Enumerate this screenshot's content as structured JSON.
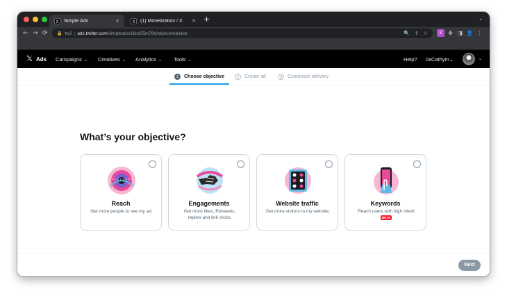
{
  "browser": {
    "tabs": [
      {
        "title": "Simple Ads",
        "favicon": "X",
        "close": "×",
        "active": true
      },
      {
        "title": "(1) Monetization / X",
        "favicon": "X",
        "close": "×",
        "active": false
      }
    ],
    "new_tab": "+",
    "tab_menu": "⌄",
    "nav": {
      "back": "←",
      "forward": "→",
      "reload": "⟳"
    },
    "address": {
      "profile": "tw2",
      "separator": "|",
      "host": "ads.twitter.com",
      "path": "/simpleads/18ce55m78rj/objectivepicker"
    },
    "omnibox_icons": {
      "zoom": "🔍",
      "share": "⇪",
      "star": "☆"
    },
    "extensions": {
      "ext1": "K",
      "puzzle": "✤",
      "sidebar": "◨",
      "profile": "👤",
      "menu": "⋮"
    }
  },
  "ads_nav": {
    "logo": "𝕏",
    "brand": "Ads",
    "menus": [
      "Campaigns",
      "Creatives",
      "Analytics",
      "Tools"
    ],
    "chevron": "⌄",
    "help": "Help?",
    "user": "0xCathym"
  },
  "stepper": {
    "steps": [
      {
        "num": "1",
        "label": "Choose objective",
        "active": true
      },
      {
        "num": "2",
        "label": "Create ad",
        "active": false
      },
      {
        "num": "3",
        "label": "Customize delivery",
        "active": false
      }
    ]
  },
  "page": {
    "heading": "What’s your objective?",
    "cards": [
      {
        "title": "Reach",
        "desc": "Get more people to see my ad.",
        "icon": "reach-illustration"
      },
      {
        "title": "Engagements",
        "desc": "Get more likes, Retweets, replies and link clicks.",
        "icon": "engagements-illustration"
      },
      {
        "title": "Website traffic",
        "desc": "Get more visitors to my website.",
        "icon": "website-traffic-illustration"
      },
      {
        "title": "Keywords",
        "desc": "Reach users with high intent",
        "badge": "BETA",
        "icon": "keywords-illustration"
      }
    ],
    "next_label": "Next"
  },
  "colors": {
    "accent": "#1d9bf0",
    "nav_bg": "#000000",
    "next_button": "#8b98a5",
    "beta_badge": "#f4212e"
  }
}
